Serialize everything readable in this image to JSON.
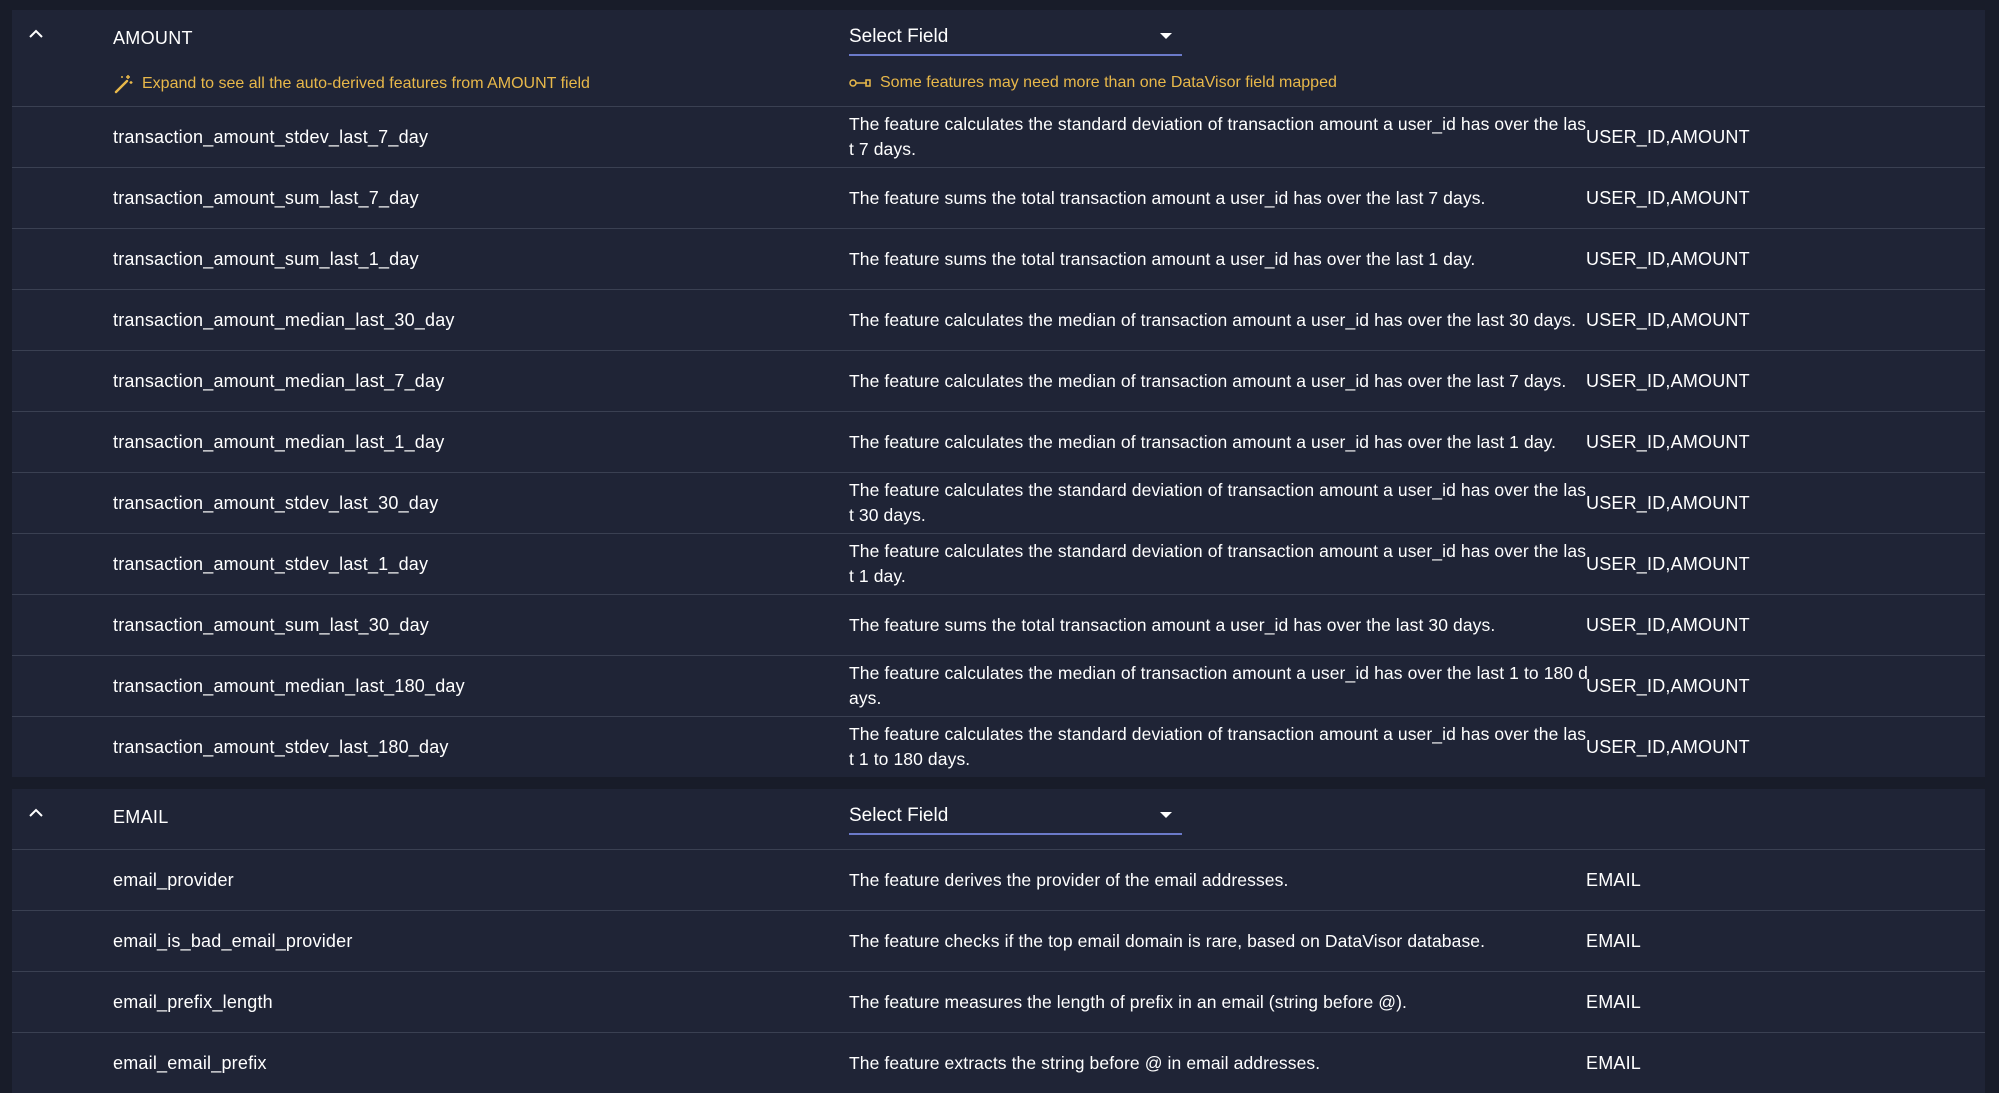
{
  "sections": [
    {
      "field": "AMOUNT",
      "select_label": "Select Field",
      "hint_expand": "Expand to see all the auto-derived features from AMOUNT field",
      "hint_mapping": "Some features may need more than one DataVisor field mapped",
      "rows": [
        {
          "name": "transaction_amount_stdev_last_7_day",
          "desc": "The feature calculates the standard deviation of transaction amount a user_id has over the last 7 days.",
          "fields": "USER_ID,AMOUNT"
        },
        {
          "name": "transaction_amount_sum_last_7_day",
          "desc": "The feature sums the total transaction amount a user_id has over the last 7 days.",
          "fields": "USER_ID,AMOUNT"
        },
        {
          "name": "transaction_amount_sum_last_1_day",
          "desc": "The feature sums the total transaction amount a user_id has over the last 1 day.",
          "fields": "USER_ID,AMOUNT"
        },
        {
          "name": "transaction_amount_median_last_30_day",
          "desc": "The feature calculates the median of transaction amount a user_id has over the last 30 days.",
          "fields": "USER_ID,AMOUNT"
        },
        {
          "name": "transaction_amount_median_last_7_day",
          "desc": "The feature calculates the median of transaction amount a user_id has over the last 7 days.",
          "fields": "USER_ID,AMOUNT"
        },
        {
          "name": "transaction_amount_median_last_1_day",
          "desc": "The feature calculates the median of transaction amount a user_id has over the last 1 day.",
          "fields": "USER_ID,AMOUNT"
        },
        {
          "name": "transaction_amount_stdev_last_30_day",
          "desc": "The feature calculates the standard deviation of transaction amount a user_id has over the last 30 days.",
          "fields": "USER_ID,AMOUNT"
        },
        {
          "name": "transaction_amount_stdev_last_1_day",
          "desc": "The feature calculates the standard deviation of transaction amount a user_id has over the last 1 day.",
          "fields": "USER_ID,AMOUNT"
        },
        {
          "name": "transaction_amount_sum_last_30_day",
          "desc": "The feature sums the total transaction amount a user_id has over the last 30 days.",
          "fields": "USER_ID,AMOUNT"
        },
        {
          "name": "transaction_amount_median_last_180_day",
          "desc": "The feature calculates the median of transaction amount a user_id has over the last 1 to 180 days.",
          "fields": "USER_ID,AMOUNT"
        },
        {
          "name": "transaction_amount_stdev_last_180_day",
          "desc": "The feature calculates the standard deviation of transaction amount a user_id has over the last 1 to 180 days.",
          "fields": "USER_ID,AMOUNT"
        }
      ]
    },
    {
      "field": "EMAIL",
      "select_label": "Select Field",
      "rows": [
        {
          "name": "email_provider",
          "desc": "The feature derives the provider of the email addresses.",
          "fields": "EMAIL"
        },
        {
          "name": "email_is_bad_email_provider",
          "desc": "The feature checks if the top email domain is rare, based on DataVisor database.",
          "fields": "EMAIL"
        },
        {
          "name": "email_prefix_length",
          "desc": "The feature measures the length of prefix in an email (string before @).",
          "fields": "EMAIL"
        },
        {
          "name": "email_email_prefix",
          "desc": "The feature extracts the string before @ in email addresses.",
          "fields": "EMAIL"
        }
      ]
    }
  ],
  "colors": {
    "background": "#181c29",
    "panel": "#1f2436",
    "divider": "#3a4052",
    "hint": "#e8b84a",
    "select_underline": "#6b7ac9"
  },
  "icons": {
    "collapse": "chevron-up-icon",
    "expand_hint": "magic-wand-icon",
    "mapping_hint": "key-link-icon",
    "select": "caret-down-icon"
  }
}
